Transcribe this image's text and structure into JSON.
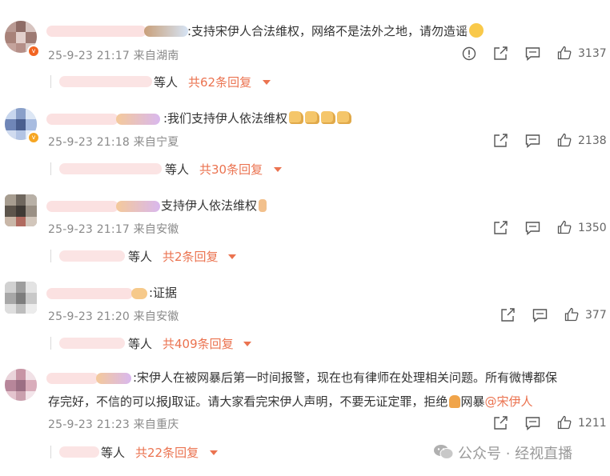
{
  "comments": [
    {
      "text": ":支持宋伊人合法维权，网络不是法外之地，请勿造谣",
      "meta": "25-9-23 21:17 来自湖南",
      "likes": "3137",
      "reply_suffix": "等人",
      "reply_count": "共62条回复",
      "has_report": true,
      "badge": "v-red"
    },
    {
      "text": ":我们支持伊人依法维权",
      "meta": "25-9-23 21:18 来自宁夏",
      "likes": "2138",
      "reply_suffix": "等人",
      "reply_count": "共30条回复",
      "has_report": false,
      "badge": "v-gold"
    },
    {
      "text": "支持伊人依法维权",
      "meta": "25-9-23 21:17 来自安徽",
      "likes": "1350",
      "reply_suffix": "等人",
      "reply_count": "共2条回复",
      "has_report": false
    },
    {
      "text": ":证据",
      "meta": "25-9-23 21:20 来自安徽",
      "likes": "377",
      "reply_suffix": "等人",
      "reply_count": "共409条回复",
      "has_report": false
    },
    {
      "text_line1": ":宋伊人在被网暴后第一时间报警，现在也有律师在处理相关问题。所有微博都保",
      "text_line2a": "存完好，不信的可以报J取证。请大家看完宋伊人声明，不要无证定罪，拒绝",
      "text_line2b": "网暴",
      "mention": "@宋伊人",
      "meta": "25-9-23 21:23 来自重庆",
      "likes": "1211",
      "reply_suffix": "等人",
      "reply_count": "共22条回复",
      "has_report": false
    }
  ],
  "watermark": "公众号 · 经视直播",
  "colors": {
    "accent": "#eb7350",
    "meta": "#8a8a8a",
    "mention": "#eb7350"
  },
  "icons": [
    "report-icon",
    "share-icon",
    "comment-icon",
    "like-icon",
    "caret-down-icon",
    "wechat-logo-icon"
  ]
}
